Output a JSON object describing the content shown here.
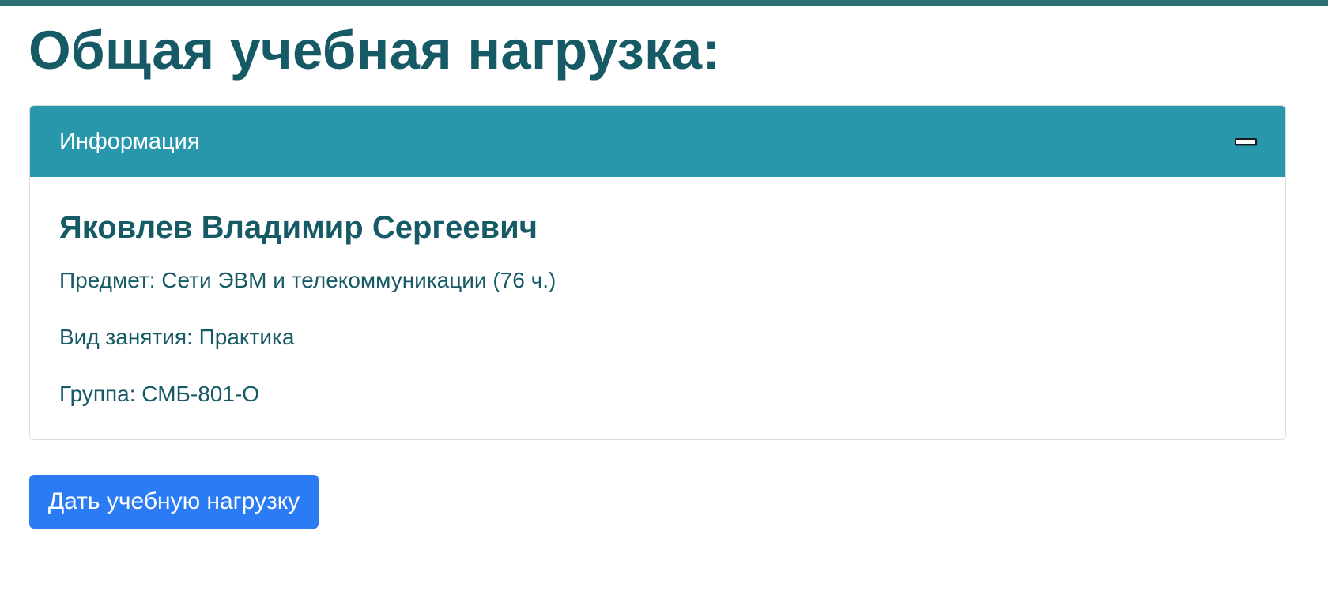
{
  "page": {
    "title": "Общая учебная нагрузка:"
  },
  "card": {
    "header_title": "Информация",
    "collapse_icon": "minus-icon",
    "teacher_name": "Яковлев Владимир Сергеевич",
    "subject_line": "Предмет: Сети ЭВМ и телекоммуникации (76 ч.)",
    "lesson_type_line": "Вид занятия: Практика",
    "group_line": "Группа: СМБ-801-О"
  },
  "actions": {
    "assign_load_label": "Дать учебную нагрузку"
  },
  "colors": {
    "top_bar": "#2b6e73",
    "title_text": "#165a66",
    "card_header_bg": "#2897ac",
    "primary_button_bg": "#2b7bf5"
  }
}
